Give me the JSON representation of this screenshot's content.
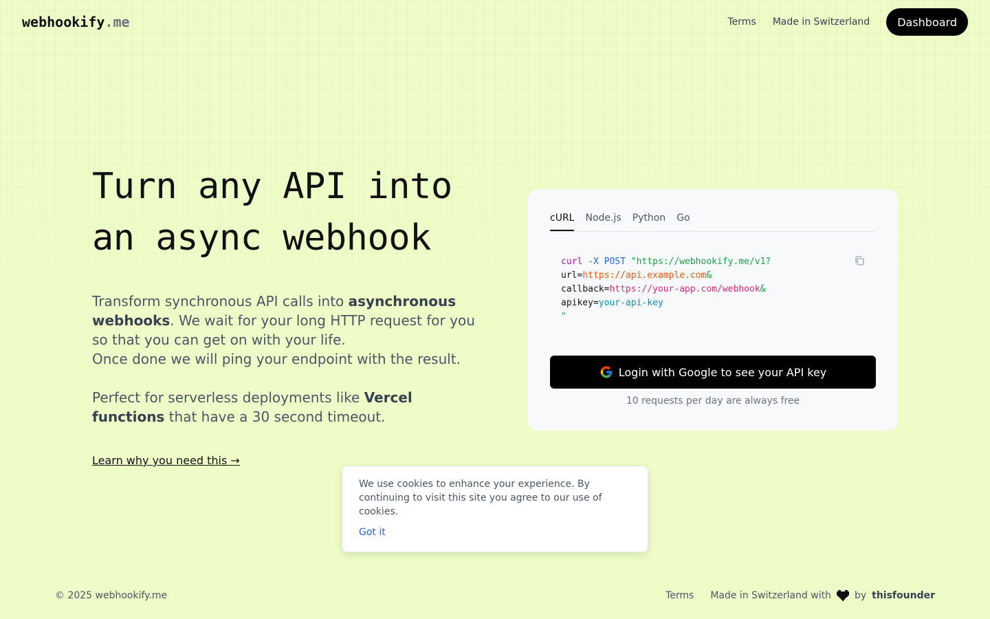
{
  "header": {
    "logo_main": "webhookify",
    "logo_tld": ".me",
    "nav_terms": "Terms",
    "nav_made": "Made in Switzerland",
    "dashboard_label": "Dashboard"
  },
  "hero": {
    "title_line1": "Turn any API into",
    "title_line2": "an async webhook",
    "p1_a": "Transform synchronous API calls into ",
    "p1_b": "asynchronous webhooks",
    "p1_c": ". We wait for your long HTTP request for you so that you can get on with your life.",
    "p1_d": "Once done we will ping your endpoint with the result.",
    "p2_a": "Perfect for serverless deployments like ",
    "p2_b": "Vercel functions",
    "p2_c": " that have a 30 second timeout.",
    "learn_link": "Learn why you need this →"
  },
  "card": {
    "tabs": [
      "cURL",
      "Node.js",
      "Python",
      "Go"
    ],
    "code": {
      "cmd": "curl",
      "flag": " -X POST",
      "url_start": " \"https://webhookify.me/v1?",
      "url_key": "url=",
      "url_val": "https://api.example.com",
      "amp1": "&",
      "cb_key": "callback=",
      "cb_val": "https://your-app.com/webhook",
      "amp2": "&",
      "api_key": "apikey=",
      "api_val": "your-api-key",
      "quote_end": "\""
    },
    "login_label": "Login with Google to see your API key",
    "free_note": "10 requests per day are always free",
    "icons": {
      "copy": "copy-icon",
      "google": "google-logo-icon"
    }
  },
  "cookie": {
    "text": "We use cookies to enhance your experience. By continuing to visit this site you agree to our use of cookies.",
    "button": "Got it"
  },
  "footer": {
    "copyright": "© 2025 webhookify.me",
    "terms": "Terms",
    "made": "Made in Switzerland with",
    "by": "by",
    "founder": "thisfounder",
    "heart_icon": "pixel-heart-icon"
  }
}
